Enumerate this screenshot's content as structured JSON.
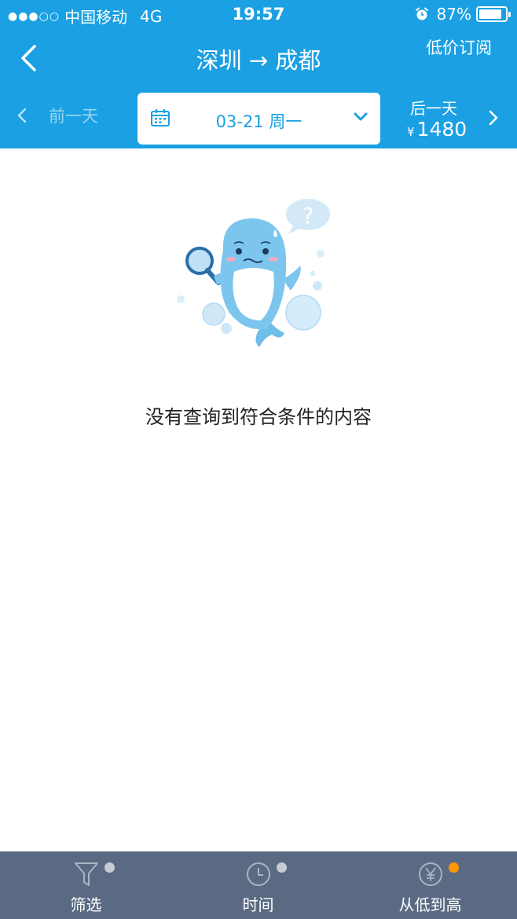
{
  "status_bar": {
    "signal": "●●●○○",
    "carrier": "中国移动",
    "network": "4G",
    "time": "19:57",
    "battery": "87%",
    "battery_level": 0.87
  },
  "nav": {
    "title": "深圳 → 成都",
    "subscribe": "低价订阅"
  },
  "date_bar": {
    "prev_label": "前一天",
    "date_label": "03-21 周一",
    "next_label": "后一天",
    "next_currency": "¥",
    "next_price": "1480"
  },
  "empty_state": {
    "question_mark": "?",
    "message": "没有查询到符合条件的内容"
  },
  "tab_bar": {
    "tabs": [
      {
        "label": "筛选",
        "icon": "filter-icon",
        "dot_color": "#c5ccd6"
      },
      {
        "label": "时间",
        "icon": "clock-icon",
        "dot_color": "#c5ccd6"
      },
      {
        "label": "从低到高",
        "icon": "yen-icon",
        "dot_color": "#ff9800"
      }
    ]
  },
  "colors": {
    "primary": "#1aa0e3",
    "tab_bar_bg": "#5a6a82",
    "active_dot": "#ff9800",
    "inactive_dot": "#c5ccd6"
  }
}
